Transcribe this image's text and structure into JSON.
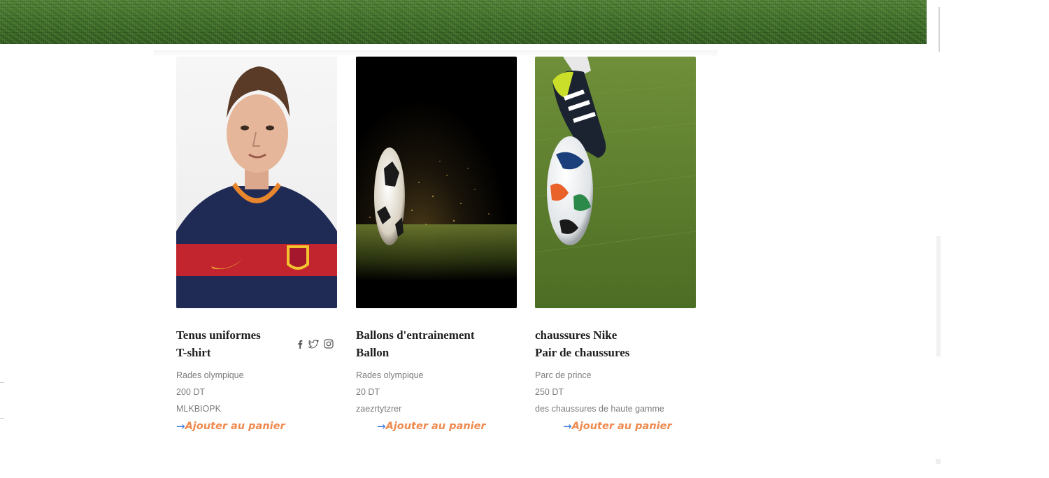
{
  "products": [
    {
      "title_line1": "Tenus uniformes",
      "title_line2": "T-shirt",
      "location": "Rades olympique",
      "price": "200 DT",
      "description": "MLKBIOPK",
      "cta_label": "Ajouter au panier",
      "image_icon": "football-player-photo"
    },
    {
      "title_line1": "Ballons d'entrainement",
      "title_line2": "Ballon",
      "location": "Rades olympique",
      "price": "20 DT",
      "description": "zaezrtytzrer",
      "cta_label": "Ajouter au panier",
      "image_icon": "soccer-ball-photo"
    },
    {
      "title_line1": "chaussures Nike",
      "title_line2": "Pair de chaussures",
      "location": "Parc de prince",
      "price": "250 DT",
      "description": "des chaussures de haute gamme",
      "cta_label": "Ajouter au panier",
      "image_icon": "cleat-and-ball-photo"
    }
  ],
  "social": [
    "facebook-icon",
    "twitter-icon",
    "instagram-icon"
  ],
  "colors": {
    "cta_text": "#ee8a4f",
    "cta_arrow": "#3d7ed8",
    "title": "#1f1f1f",
    "meta": "#7d7d7d",
    "banner_grass": "#3f6b2a"
  }
}
